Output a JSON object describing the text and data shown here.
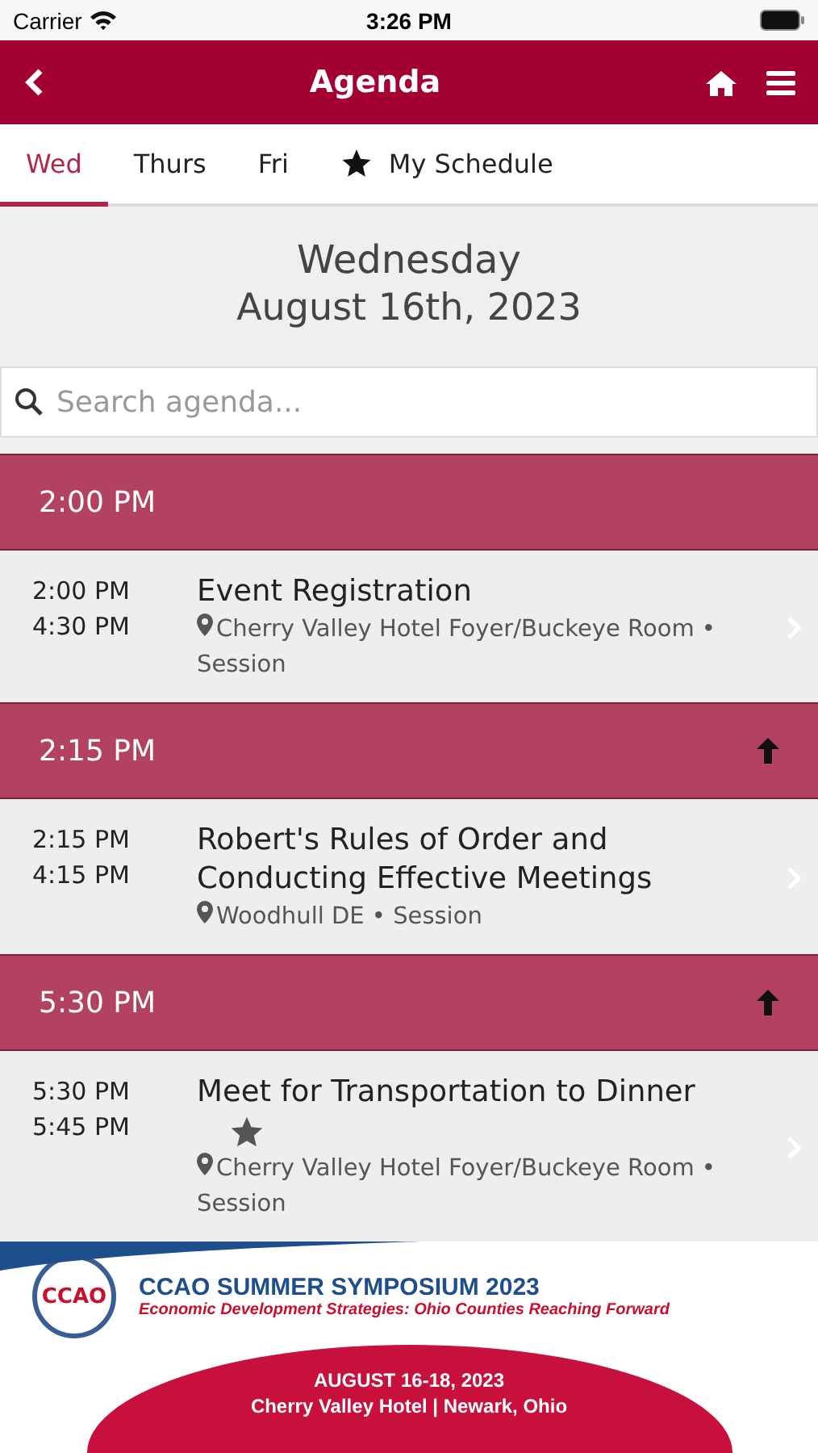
{
  "status_bar": {
    "carrier": "Carrier",
    "time": "3:26 PM"
  },
  "nav": {
    "title": "Agenda"
  },
  "tabs": [
    {
      "label": "Wed",
      "selected": true,
      "kind": "day"
    },
    {
      "label": "Thurs",
      "selected": false,
      "kind": "day"
    },
    {
      "label": "Fri",
      "selected": false,
      "kind": "day"
    },
    {
      "label": "My Schedule",
      "selected": false,
      "kind": "starred"
    }
  ],
  "date_header": {
    "weekday": "Wednesday",
    "date": "August 16th, 2023"
  },
  "search": {
    "placeholder": "Search agenda..."
  },
  "sections": [
    {
      "time": "2:00 PM",
      "up_arrow": false,
      "events": [
        {
          "start": "2:00 PM",
          "end": "4:30 PM",
          "title": "Event Registration",
          "starred": false,
          "location": "Cherry Valley Hotel Foyer/Buckeye Room • Session"
        }
      ]
    },
    {
      "time": "2:15 PM",
      "up_arrow": true,
      "events": [
        {
          "start": "2:15 PM",
          "end": "4:15 PM",
          "title": "Robert's Rules of Order and Conducting Effective Meetings",
          "starred": false,
          "location": "Woodhull DE • Session"
        }
      ]
    },
    {
      "time": "5:30 PM",
      "up_arrow": true,
      "events": [
        {
          "start": "5:30 PM",
          "end": "5:45 PM",
          "title": "Meet for Transportation to Dinner",
          "starred": true,
          "location": "Cherry Valley Hotel Foyer/Buckeye Room • Session"
        }
      ]
    }
  ],
  "banner": {
    "logo": "CCAO",
    "title": "CCAO SUMMER SYMPOSIUM 2023",
    "subtitle": "Economic Development Strategies: Ohio Counties Reaching Forward",
    "dates": "AUGUST 16-18, 2023",
    "venue": "Cherry Valley Hotel | Newark, Ohio"
  }
}
